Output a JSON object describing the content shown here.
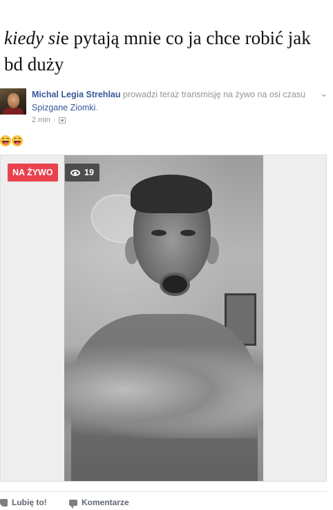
{
  "caption": {
    "italic_part": "kiedy si",
    "rest": "e pytają mnie co ja chce robić jak bd duży"
  },
  "post": {
    "author": "Michal Legia Strehlau",
    "action_text": " prowadzi teraz transmisję na żywo na osi czasu ",
    "group": "Spizgane Ziomki",
    "group_suffix": ".",
    "time": "2 min",
    "privacy_icon": "audience-icon",
    "options_icon": "chevron-down-icon"
  },
  "reactions": [
    "laughing-emoji",
    "laughing-emoji"
  ],
  "video": {
    "live_label": "NA ŻYWO",
    "viewers": "19",
    "viewer_icon": "eye-icon"
  },
  "actions": {
    "like_label": "Lubię to!",
    "comment_label": "Komentarze"
  },
  "colors": {
    "live_badge": "#e9414e",
    "link": "#365899",
    "meta": "#90949c"
  }
}
